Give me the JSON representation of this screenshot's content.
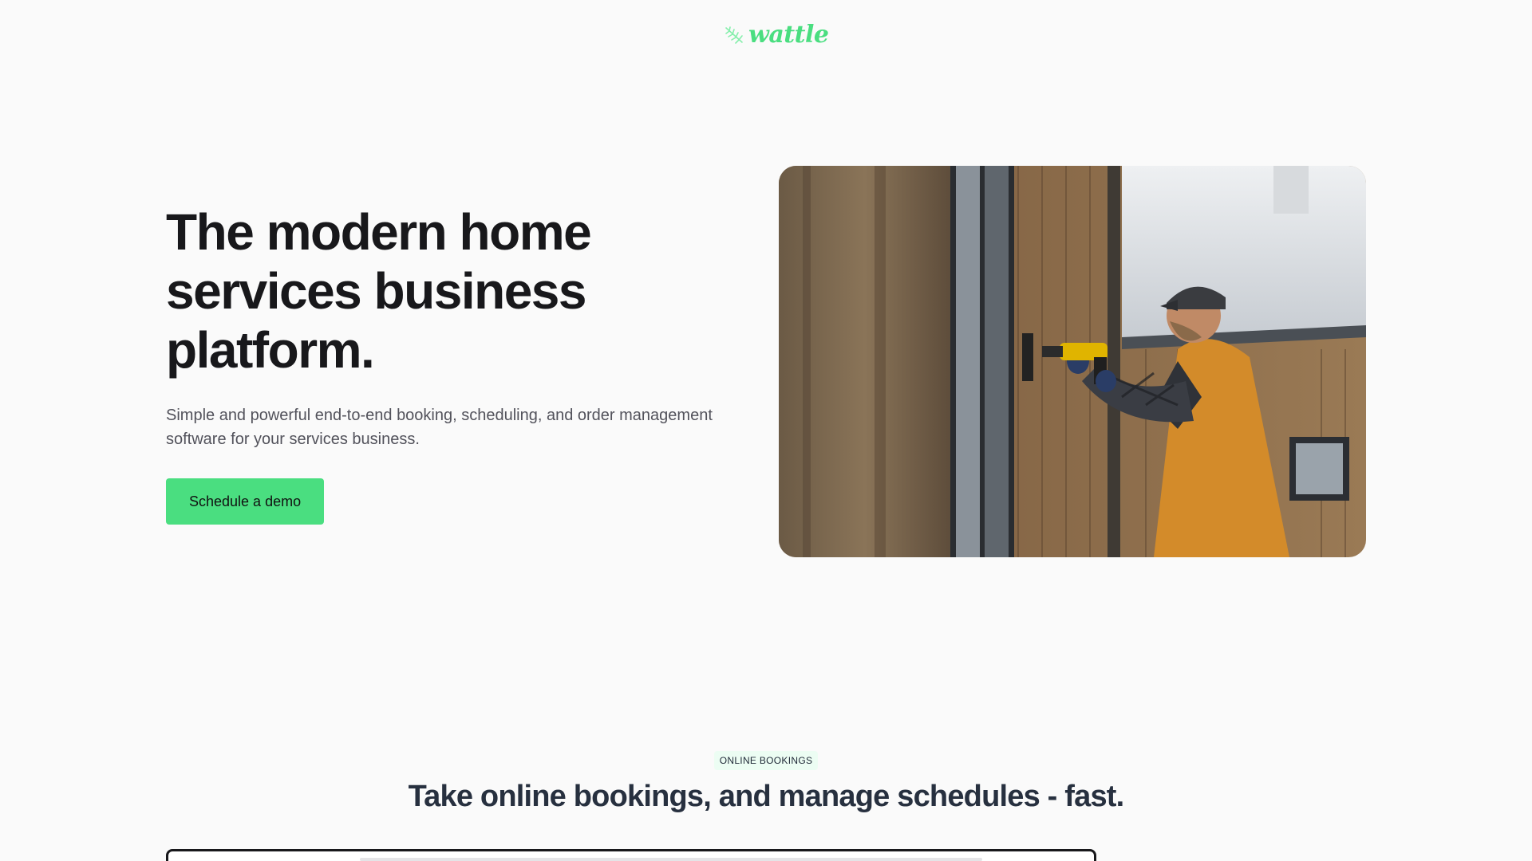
{
  "brand": {
    "logo_text": "wattle",
    "accent_color": "#4ade80"
  },
  "hero": {
    "title": "The modern home services business platform.",
    "subtitle": "Simple and powerful end-to-end booking, scheduling, and order management software for your services business.",
    "cta_label": "Schedule a demo"
  },
  "section_bookings": {
    "badge": "ONLINE BOOKINGS",
    "title": "Take online bookings, and manage schedules - fast."
  }
}
